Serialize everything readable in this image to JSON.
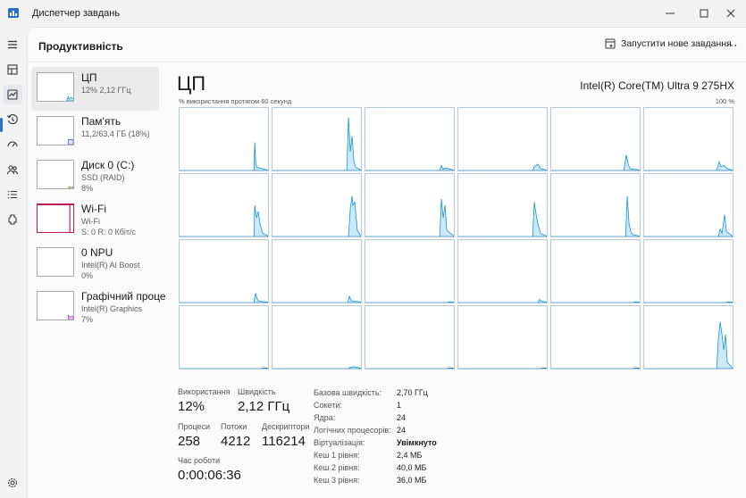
{
  "app": {
    "title": "Диспетчер завдань"
  },
  "header": {
    "title": "Продуктивність",
    "run_task_label": "Запустити нове завдання"
  },
  "colors": {
    "accent": "#2a6fc9",
    "cpu_line": "#1795d2",
    "cpu_fill": "#cde8f6",
    "memory": "#7b6bd6",
    "disk": "#6aa84f",
    "wifi": "#c2185b",
    "gpu": "#a03bd0"
  },
  "icons": [
    "hamburger-menu-icon",
    "processes-icon",
    "performance-icon",
    "app-history-icon",
    "startup-apps-icon",
    "users-icon",
    "details-icon",
    "services-icon",
    "settings-icon",
    "run-task-icon",
    "more-options-icon"
  ],
  "resources": [
    {
      "title": "ЦП",
      "sub1": "12% 2,12 ГГц",
      "sub2": "",
      "usage": 0.12
    },
    {
      "title": "Пам'ять",
      "sub1": "11,2/63,4 ГБ (18%)",
      "sub2": "",
      "usage": 0.18
    },
    {
      "title": "Диск 0 (C:)",
      "sub1": "SSD (RAID)",
      "sub2": "8%",
      "usage": 0.08
    },
    {
      "title": "Wi-Fi",
      "sub1": "Wi-Fi",
      "sub2": "S: 0 R: 0 Кбіт/с",
      "usage": 0
    },
    {
      "title": "0 NPU",
      "sub1": "Intel(R) AI Boost",
      "sub2": "0%",
      "usage": 0
    },
    {
      "title": "Графічний проце",
      "sub1": "Intel(R) Graphics",
      "sub2": "7%",
      "usage": 0.07
    }
  ],
  "cpu": {
    "title": "ЦП",
    "model": "Intel(R) Core(TM) Ultra 9 275HX",
    "graph_caption": "% використання протягом 60 секунд",
    "graph_max": "100 %",
    "core_count": 24
  },
  "stats": {
    "utilization_label": "Використання",
    "utilization_value": "12%",
    "speed_label": "Швидкість",
    "speed_value": "2,12 ГГц",
    "processes_label": "Процеси",
    "processes_value": "258",
    "threads_label": "Потоки",
    "threads_value": "4212",
    "handles_label": "Дескриптори",
    "handles_value": "116214",
    "uptime_label": "Час роботи",
    "uptime_value": "0:00:06:36"
  },
  "details": [
    {
      "label": "Базова швидкість:",
      "value": "2,70 ГГц"
    },
    {
      "label": "Сокети:",
      "value": "1"
    },
    {
      "label": "Ядра:",
      "value": "24"
    },
    {
      "label": "Логічних процесорів:",
      "value": "24"
    },
    {
      "label": "Віртуалізація:",
      "value": "Увімкнуто"
    },
    {
      "label": "Кеш 1 рівня:",
      "value": "2,4 МБ"
    },
    {
      "label": "Кеш 2 рівня:",
      "value": "40,0 МБ"
    },
    {
      "label": "Кеш 3 рівня:",
      "value": "36,0 МБ"
    }
  ]
}
